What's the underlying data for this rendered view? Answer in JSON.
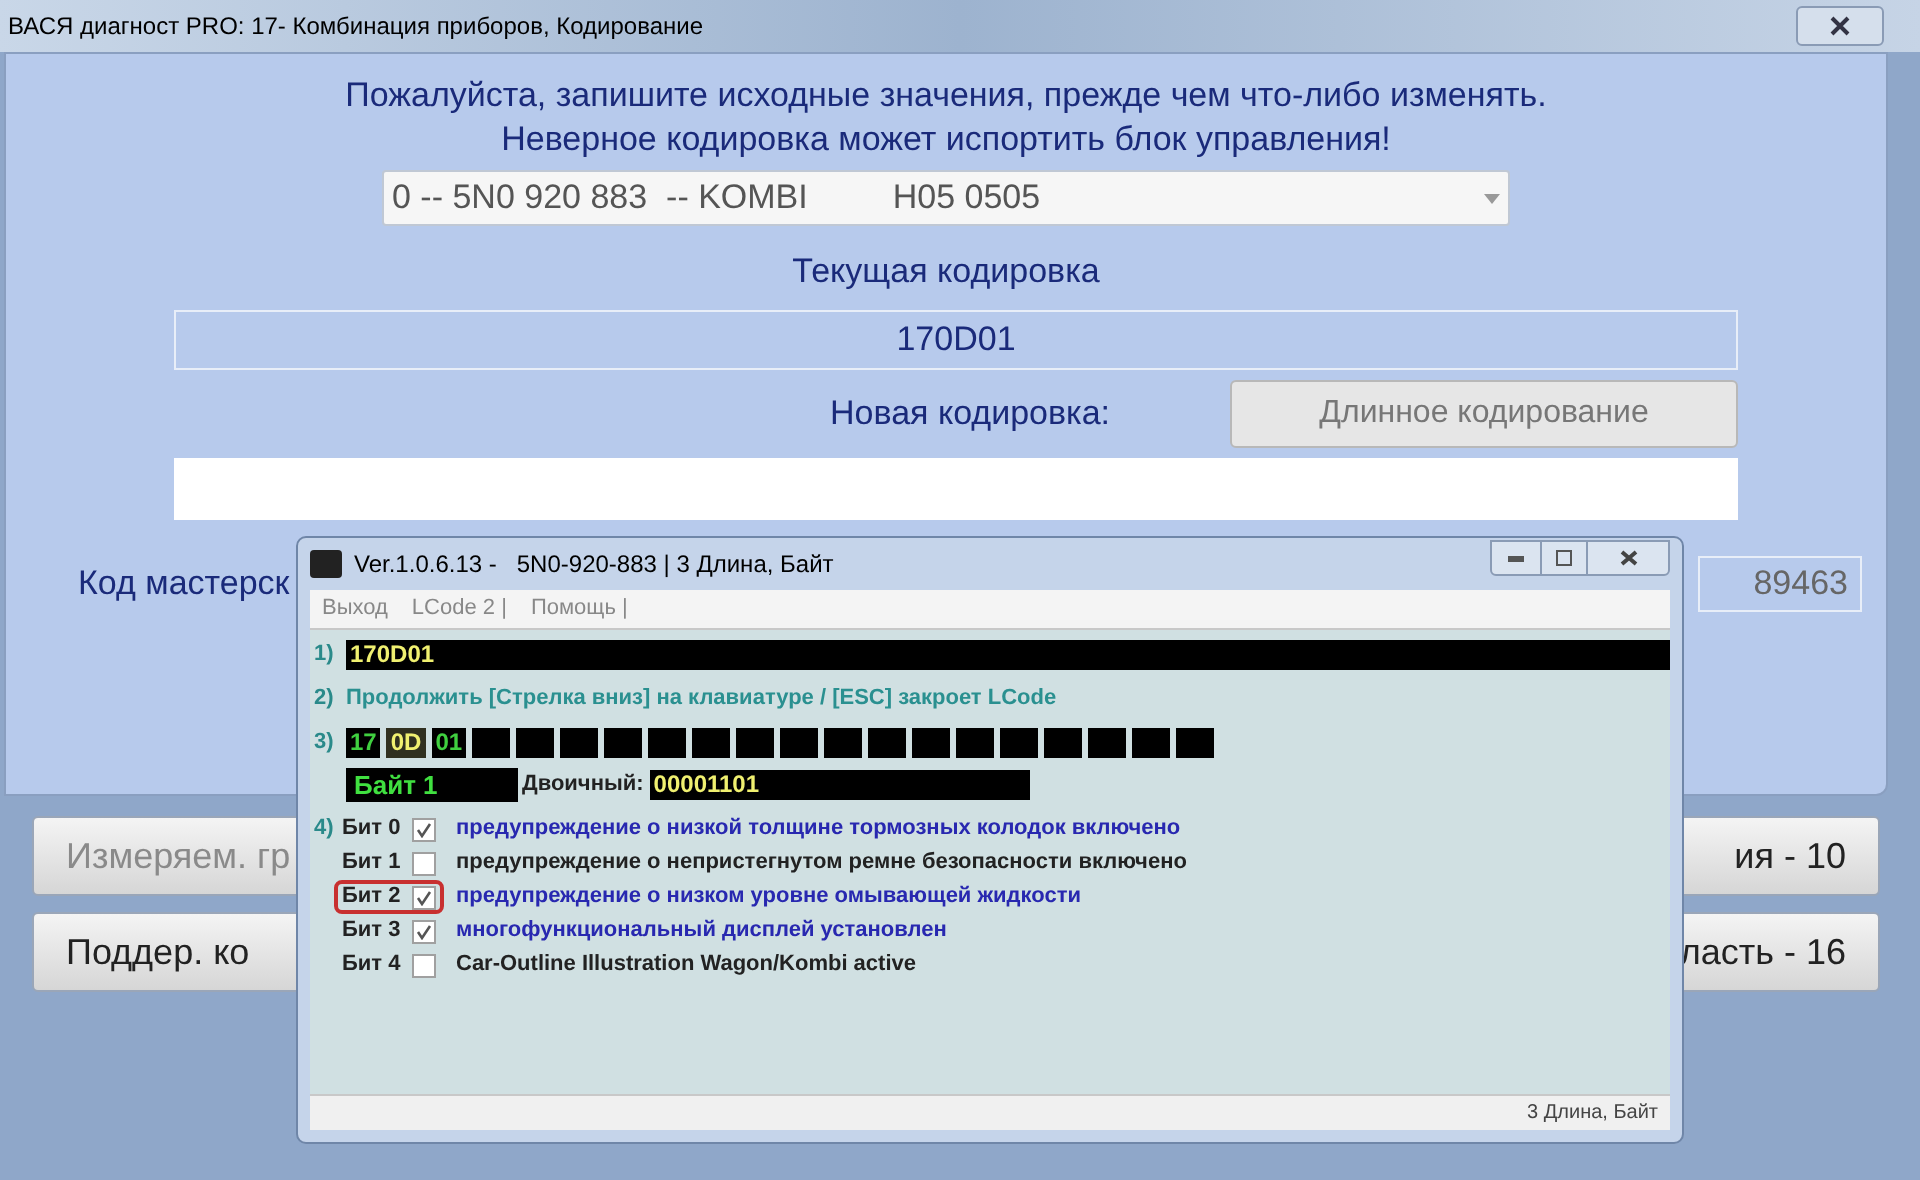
{
  "window": {
    "title": "ВАСЯ диагност PRO: 17- Комбинация приборов,  Кодирование"
  },
  "warning_lines": [
    "Пожалуйста, запишите исходные значения, прежде чем что-либо изменять.",
    "Неверное кодировка может испортить блок управления!"
  ],
  "module_select": {
    "value": "0 -- 5N0 920 883  -- KOMBI         H05 0505"
  },
  "current_coding": {
    "label": "Текущая кодировка",
    "value": "170D01"
  },
  "new_coding": {
    "label": "Новая кодировка:",
    "long_coding_button": "Длинное кодирование"
  },
  "workshop_code": {
    "label": "Код мастерск",
    "value": "89463"
  },
  "buttons": [
    {
      "label": "Измеряем. гр",
      "disabled": true
    },
    {
      "label": "ия - 10",
      "disabled": false
    },
    {
      "label": "Поддер. ко",
      "disabled": false
    },
    {
      "label": "ласть - 16",
      "disabled": false
    }
  ],
  "lcode_dialog": {
    "title": "Ver.1.0.6.13 -   5N0-920-883 | 3 Длина, Байт",
    "menu": [
      "Выход",
      "LCode 2 |",
      "Помощь |"
    ],
    "step_labels": [
      "1)",
      "2)",
      "3)",
      "4)"
    ],
    "coding": "170D01",
    "hint": "Продолжить [Стрелка вниз] на клавиатуре / [ESC] закроет LCode",
    "bytes": [
      {
        "value": "17",
        "selected": false
      },
      {
        "value": "0D",
        "selected": true
      },
      {
        "value": "01",
        "selected": false
      }
    ],
    "byte_label": "Байт 1",
    "binary_label": "Двоичный:",
    "binary_value": "00001101",
    "bits": [
      {
        "label": "Бит 0",
        "checked": true,
        "highlighted": false,
        "text": "предупреждение о низкой толщине тормозных колодок включено"
      },
      {
        "label": "Бит 1",
        "checked": false,
        "highlighted": false,
        "text": "предупреждение о непристегнутом ремне безопасности включено"
      },
      {
        "label": "Бит 2",
        "checked": true,
        "highlighted": true,
        "text": "предупреждение о низком уровне омывающей жидкости"
      },
      {
        "label": "Бит 3",
        "checked": true,
        "highlighted": false,
        "text": "многофункциональный дисплей установлен"
      },
      {
        "label": "Бит 4",
        "checked": false,
        "highlighted": false,
        "text": "Car-Outline Illustration Wagon/Kombi active"
      }
    ],
    "status": "3 Длина, Байт"
  }
}
